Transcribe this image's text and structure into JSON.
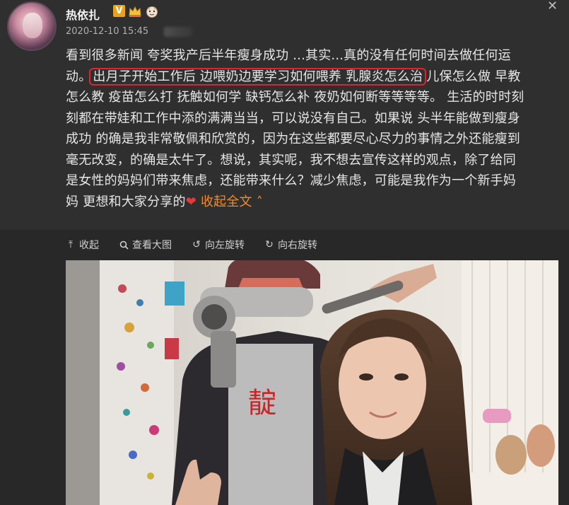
{
  "post": {
    "username": "热依扎",
    "timestamp": "2020-12-10 15:45",
    "badges": [
      "verified-v-badge",
      "crown-badge",
      "emoji-face-badge"
    ],
    "text_lines": [
      "看到很多新闻 夸奖我产后半年瘦身成功 ...其实...真的没有任何时间去做任何运",
      "怎么教 疫苗怎么打 抚触如何学 缺钙怎么补 夜奶如何断等等等等。 生活的时时刻",
      "刻都在带娃和工作中添的满满当当，可以说没有自己。如果说 头半年能做到瘦身",
      "成功 的确是我非常敬佩和欣赏的，因为在这些都要尽心尽力的事情之外还能瘦到",
      "毫无改变，的确是太牛了。想说，其实呢，我不想去宣传这样的观点，除了给同",
      "是女性的妈妈们带来焦虑，还能带来什么？减少焦虑，可能是我作为一个新手妈"
    ],
    "line2_prefix": "动。",
    "line2_highlight": "出月子开始工作后 边喂奶边要学习如何喂养 乳腺炎怎么治",
    "line2_suffix": "儿保怎么做 早教",
    "last_line_text": "妈 更想和大家分享的",
    "collapse_label": "收起全文",
    "collapse_arrow": "^"
  },
  "toolbar": {
    "collapse": "收起",
    "view_large": "查看大图",
    "rotate_left": "向左旋转",
    "rotate_right": "向右旋转"
  },
  "photo_text": "靛",
  "colors": {
    "highlight_border": "#e6212a",
    "collapse_link": "#f08b2c",
    "heart": "#e23a3a",
    "verified_badge": "#e8a21c"
  }
}
